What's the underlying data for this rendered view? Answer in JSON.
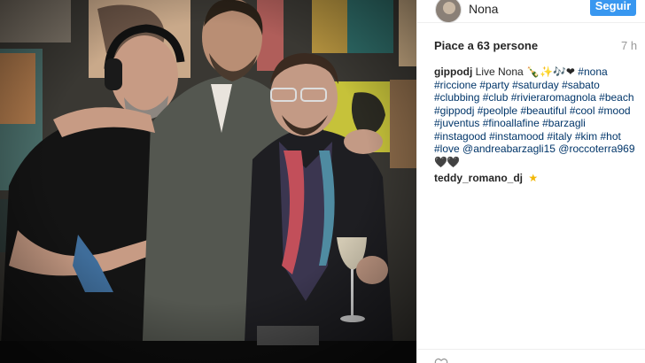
{
  "post": {
    "username": "Nona",
    "follow_label": "Seguir",
    "likes_text": "Piace a 63 persone",
    "time_ago": "7 h",
    "caption": {
      "author": "gippodj",
      "text_before": "Live Nona",
      "emoji": "🍾✨🎶❤",
      "hashtags": [
        "#nona",
        "#riccione",
        "#party",
        "#saturday",
        "#sabato",
        "#clubbing",
        "#club",
        "#rivieraromagnola",
        "#beach",
        "#gippodj",
        "#peolple",
        "#beautiful",
        "#cool",
        "#mood",
        "#juventus",
        "#finoallafine",
        "#barzagli",
        "#instagood",
        "#instamood",
        "#italy",
        "#kim",
        "#hot",
        "#love"
      ],
      "mentions": [
        "@andreabarzagli15",
        "@roccoterra969"
      ],
      "hearts": "🖤🖤"
    },
    "comment": {
      "author": "teddy_romano_dj",
      "emoji": "★"
    }
  },
  "colors": {
    "follow_button": "#3897f0",
    "hashtag": "#003569"
  },
  "icons": {
    "like": "heart-icon"
  }
}
